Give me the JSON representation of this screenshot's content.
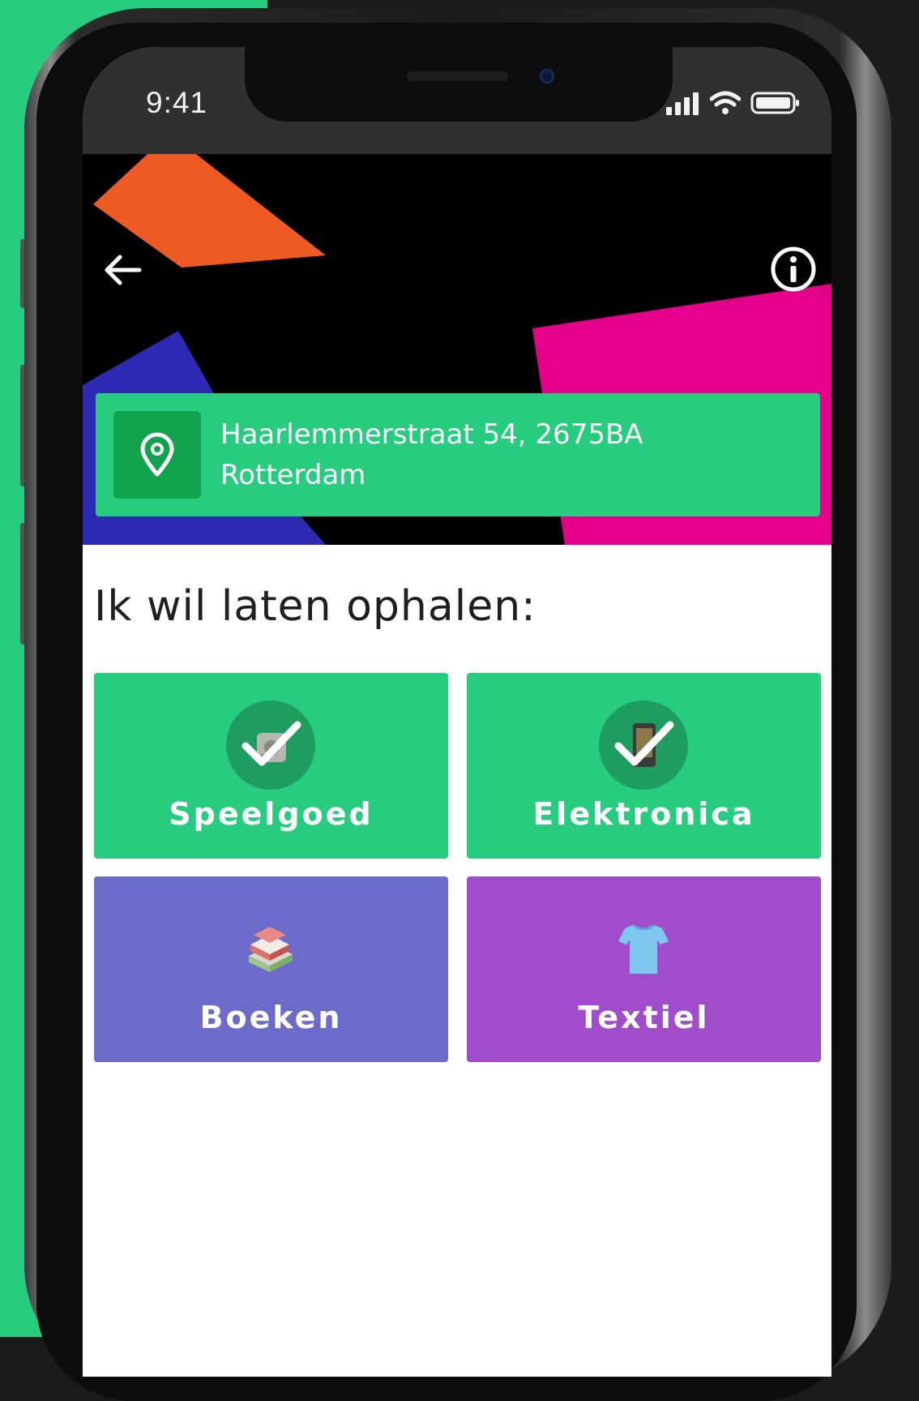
{
  "status_bar": {
    "time": "9:41"
  },
  "address": {
    "line1": "Haarlemmerstraat 54, 2675BA",
    "line2": "Rotterdam"
  },
  "heading": "Ik wil laten ophalen:",
  "categories": [
    {
      "label": "Speelgoed",
      "selected": true,
      "color": "#27cc7e",
      "icon": "toy-icon"
    },
    {
      "label": "Elektronica",
      "selected": true,
      "color": "#27cc7e",
      "icon": "phone-icon"
    },
    {
      "label": "Boeken",
      "selected": false,
      "color": "#6c6bc9",
      "icon": "books-icon"
    },
    {
      "label": "Textiel",
      "selected": false,
      "color": "#a04ccb",
      "icon": "tshirt-icon"
    }
  ],
  "colors": {
    "brand_green": "#27cc7e",
    "pin_green": "#10a24d",
    "hero_orange": "#ee5a24",
    "hero_pink": "#e4008a",
    "hero_blue": "#2d2ab4"
  }
}
